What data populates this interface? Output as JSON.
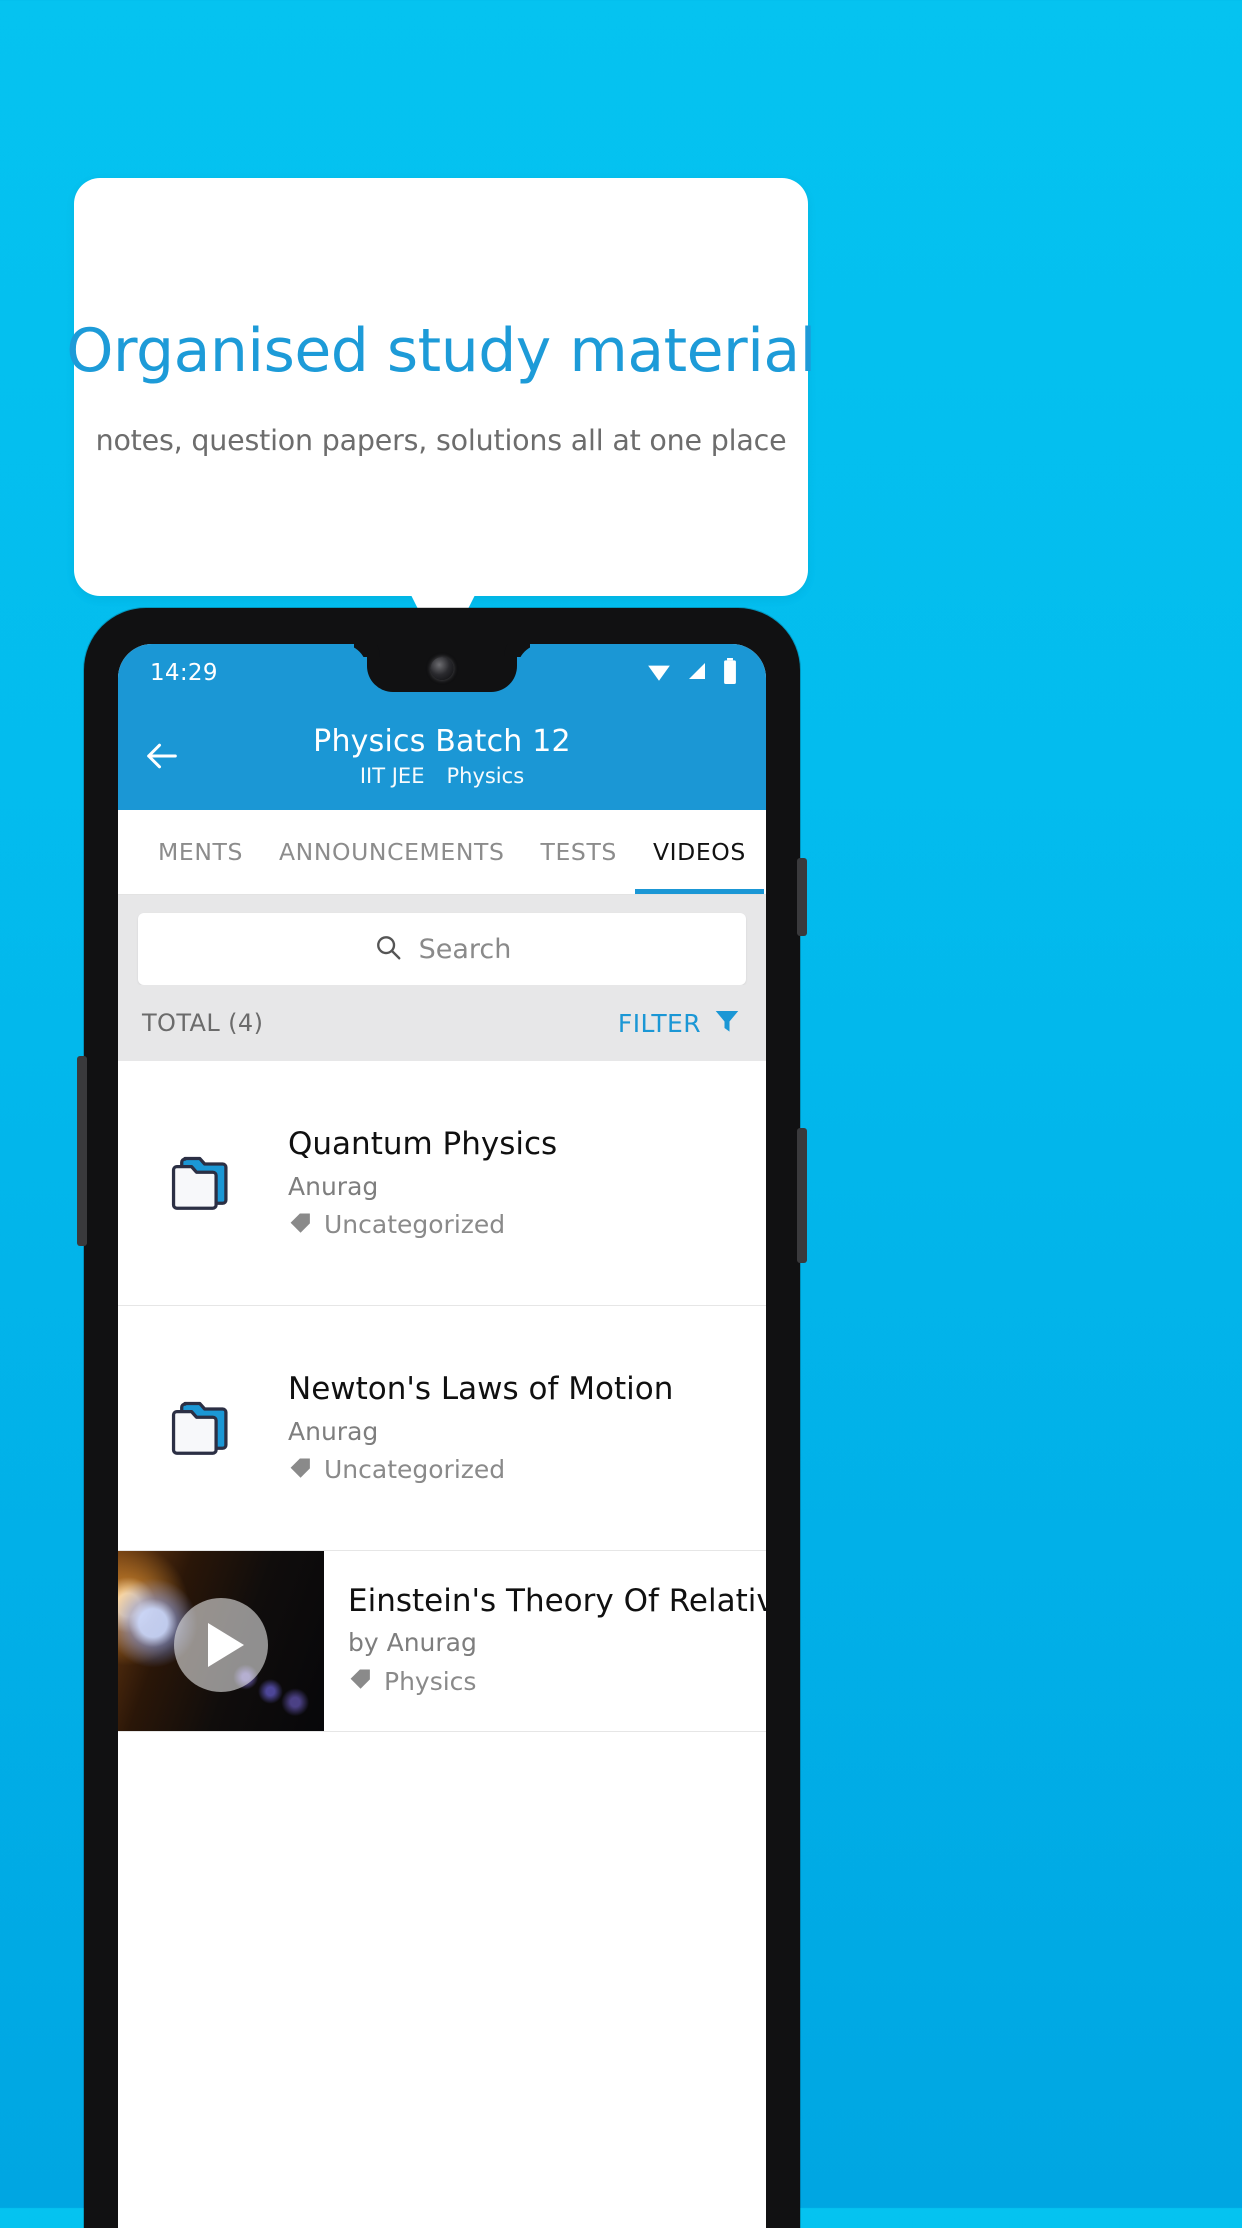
{
  "promo": {
    "title": "Organised study material",
    "subtitle": "notes, question papers, solutions all at one place",
    "accent_color": "#1d9bd8",
    "background_color": "#03bcee"
  },
  "phone": {
    "status_bar": {
      "time": "14:29",
      "icons": [
        "wifi-icon",
        "signal-icon",
        "battery-icon"
      ]
    },
    "app_bar": {
      "back_icon": "back-arrow-icon",
      "title": "Physics Batch 12",
      "subtitle_exam": "IIT JEE",
      "subtitle_subject": "Physics",
      "color": "#1b97d5"
    },
    "tabs": [
      {
        "label": "MENTS",
        "active": false
      },
      {
        "label": "ANNOUNCEMENTS",
        "active": false
      },
      {
        "label": "TESTS",
        "active": false
      },
      {
        "label": "VIDEOS",
        "active": true
      }
    ],
    "search": {
      "placeholder": "Search",
      "icon": "search-icon"
    },
    "toolbar": {
      "total_label": "TOTAL (4)",
      "filter_label": "FILTER",
      "filter_icon": "filter-funnel-icon"
    },
    "list": [
      {
        "icon": "folder-icon",
        "title": "Quantum Physics",
        "author": "Anurag",
        "tag_icon": "tag-icon",
        "tag": "Uncategorized"
      },
      {
        "icon": "folder-icon",
        "title": "Newton's Laws of Motion",
        "author": "Anurag",
        "tag_icon": "tag-icon",
        "tag": "Uncategorized"
      },
      {
        "icon": "video-thumbnail",
        "play_icon": "play-icon",
        "title": "Einstein's Theory Of Relativity",
        "author": "by Anurag",
        "tag_icon": "tag-icon",
        "tag": "Physics"
      }
    ]
  }
}
